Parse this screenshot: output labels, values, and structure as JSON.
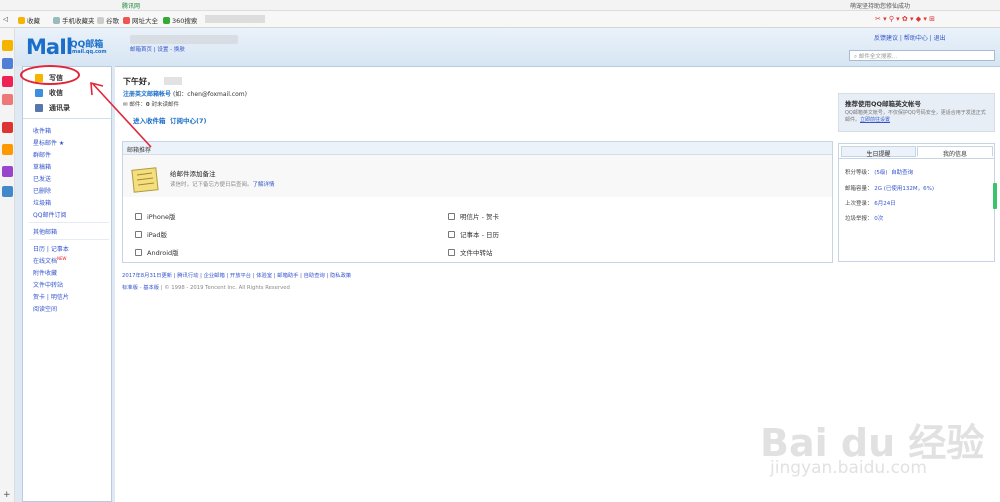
{
  "browser": {
    "tab_title": "腾讯网",
    "right_text": "萌宠坚持助您修仙成功",
    "bookmarks": [
      "收藏",
      "手机收藏夹",
      "谷歌",
      "网址大全",
      "360搜索"
    ]
  },
  "header": {
    "logo_main": "MaIl",
    "logo_text": "QQ邮箱",
    "logo_sub": "mail.qq.com",
    "links": "邮箱首页 | 设置 - 换肤",
    "right_links": "反馈建议 | 帮助中心 | 退出",
    "search_placeholder": "邮件全文搜索..."
  },
  "sidebar": {
    "write": "写信",
    "receive": "收信",
    "contacts": "通讯录",
    "folders": [
      "收件箱",
      "星标邮件 ★",
      "群邮件",
      "草稿箱",
      "已发送",
      "已删除",
      "垃圾箱",
      "QQ邮件订阅"
    ],
    "other": "其他邮箱",
    "apps": [
      "日历 | 记事本",
      "在线文档",
      "附件收藏",
      "文件中转站",
      "贺卡 | 明信片",
      "阅读空间"
    ],
    "new_badge": "NEW"
  },
  "main": {
    "greeting": "下午好，",
    "register": "注册英文邮箱帐号",
    "register_example": "(如：chen@foxmail.com)",
    "mail_count_label": "邮件：",
    "mail_count_value": "0",
    "mail_count_suffix": "封未读邮件",
    "inbox_link": "进入收件箱",
    "subscription_link": "订阅中心(7)"
  },
  "recommend": {
    "header": "邮箱推荐",
    "note_title": "给邮件添加备注",
    "note_desc": "读信时，记下备忘方便日后查阅。",
    "note_more": "了解详情",
    "links": [
      "iPhone版",
      "iPad版",
      "Android版",
      "明信片 - 贺卡",
      "记事本 - 日历",
      "文件中转站"
    ]
  },
  "footer": {
    "line1": "2017年8月31日更新 | 腾讯行动 | 企业邮箱 | 开放平台 | 体验室 | 邮箱助手 | 自助查询 | 隐私政策",
    "std": "标准版",
    "basic": "基本版",
    "copyright": "| © 1998 - 2019 Tencent Inc. All Rights Reserved"
  },
  "promo": {
    "title": "推荐使用QQ邮箱英文帐号",
    "desc": "QQ邮箱英文帐号，不仅保护QQ号码安全，更适合用于发送正式邮件。",
    "link": "立即前往设置"
  },
  "info": {
    "tab_birthday": "生日提醒",
    "tab_myinfo": "我的信息",
    "rows": [
      {
        "label": "积分等级：",
        "value": "(5级)",
        "extra": "自助查询"
      },
      {
        "label": "邮箱容量：",
        "value": "2G",
        "extra": "(已使用132M，6%)"
      },
      {
        "label": "上次登录：",
        "value": "6月24日",
        "extra": ""
      },
      {
        "label": "垃圾举报：",
        "value": "0次",
        "extra": ""
      }
    ]
  },
  "watermark": {
    "main": "Bai du 经验",
    "sub": "jingyan.baidu.com"
  },
  "colors": {
    "accent": "#1b6fc9",
    "link": "#3355cc",
    "annotation": "#e2263a"
  }
}
